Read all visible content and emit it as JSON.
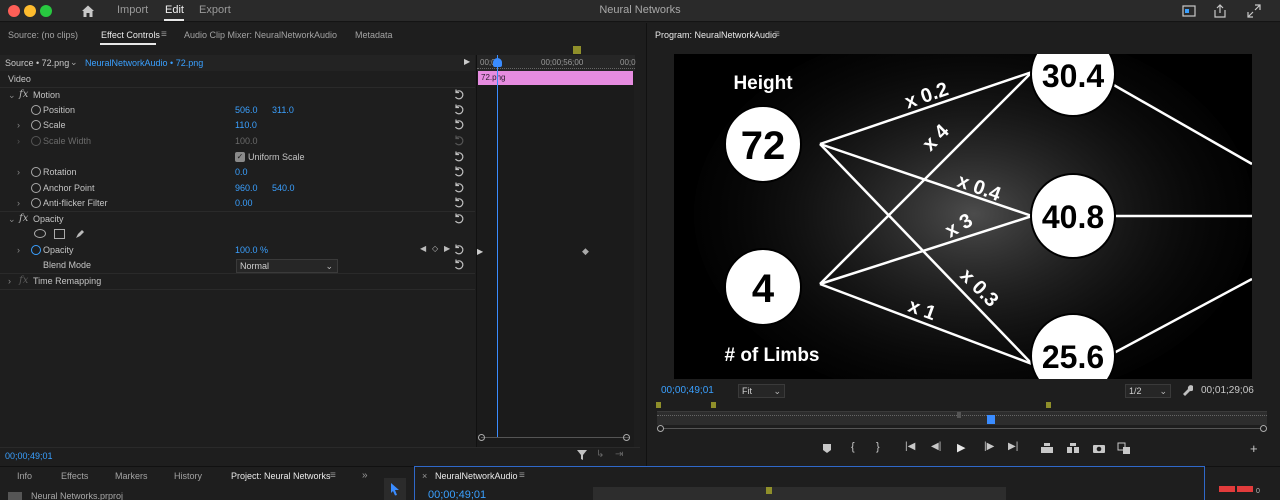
{
  "app": {
    "title": "Neural Networks",
    "workspace_tabs": [
      "Import",
      "Edit",
      "Export"
    ],
    "active_workspace": "Edit"
  },
  "effect_controls": {
    "tabs": [
      "Source: (no clips)",
      "Effect Controls",
      "Audio Clip Mixer: NeuralNetworkAudio",
      "Metadata"
    ],
    "source_label": "Source • 72.png",
    "sequence_label": "NeuralNetworkAudio • 72.png",
    "video_header": "Video",
    "motion_label": "Motion",
    "position_label": "Position",
    "position_x": "506.0",
    "position_y": "311.0",
    "scale_label": "Scale",
    "scale_value": "110.0",
    "scale_width_label": "Scale Width",
    "scale_width_value": "100.0",
    "uniform_scale_label": "Uniform Scale",
    "rotation_label": "Rotation",
    "rotation_value": "0.0",
    "anchor_label": "Anchor Point",
    "anchor_x": "960.0",
    "anchor_y": "540.0",
    "antiflicker_label": "Anti-flicker Filter",
    "antiflicker_value": "0.00",
    "opacity_section_label": "Opacity",
    "opacity_label": "Opacity",
    "opacity_value": "100.0 %",
    "blend_label": "Blend Mode",
    "blend_value": "Normal",
    "time_remap_label": "Time Remapping",
    "timecode": "00;00;49;01",
    "ruler_left": "00;00",
    "ruler_mid": "00;00;56;00",
    "ruler_right": "00;0",
    "clip_name": "72.png"
  },
  "program_monitor": {
    "title": "Program: NeuralNetworkAudio",
    "current_timecode": "00;00;49;01",
    "fit_value": "Fit",
    "resolution_value": "1/2",
    "duration": "00;01;29;06",
    "video": {
      "height_label": "Height",
      "height_value": "72",
      "limbs_label": "# of Limbs",
      "limbs_value": "4",
      "output_top": "30.4",
      "output_mid": "40.8",
      "output_bottom": "25.6",
      "weight_1": "x 0.2",
      "weight_2": "x 4",
      "weight_3": "x 0.4",
      "weight_4": "x 3",
      "weight_5": "x 0.3",
      "weight_6": "x 1"
    }
  },
  "bottom": {
    "tabs": [
      "Info",
      "Effects",
      "Markers",
      "History",
      "Project: Neural Networks"
    ],
    "project_item": "Neural Networks.prproj",
    "sequence_tab": "NeuralNetworkAudio",
    "sequence_timecode": "00;00;49;01"
  }
}
